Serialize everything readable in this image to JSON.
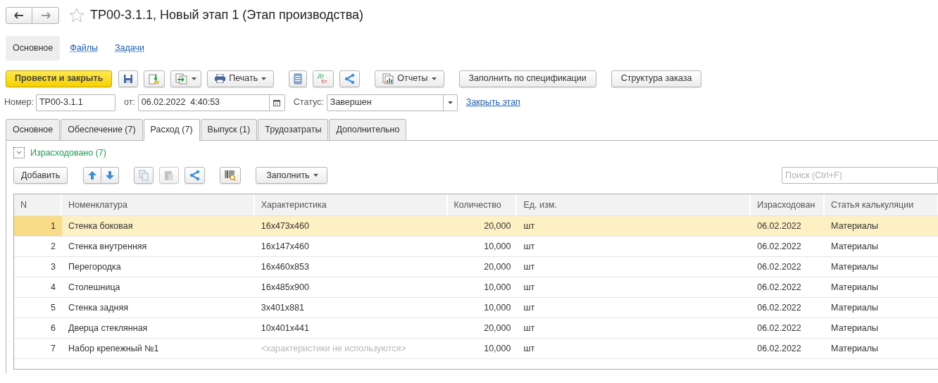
{
  "window": {
    "title": "ТР00-3.1.1, Новый этап 1 (Этап производства)",
    "favorite": false
  },
  "sections": [
    {
      "label": "Основное",
      "selected": true
    },
    {
      "label": "Файлы",
      "selected": false
    },
    {
      "label": "Задачи",
      "selected": false
    }
  ],
  "toolbar": {
    "primary": "Провести и закрыть",
    "print": "Печать",
    "reports": "Отчеты",
    "fill_spec": "Заполнить по спецификации",
    "structure": "Структура заказа",
    "debit_credit": [
      "Дт",
      "Кт"
    ]
  },
  "header": {
    "number_label": "Номер:",
    "number": "ТР00-3.1.1",
    "date_label": "от:",
    "date": "06.02.2022  4:40:53",
    "status_label": "Статус:",
    "status": "Завершен",
    "close_link": "Закрыть этап"
  },
  "tabs": [
    {
      "label": "Основное",
      "selected": false
    },
    {
      "label": "Обеспечение (7)",
      "selected": false
    },
    {
      "label": "Расход (7)",
      "selected": true
    },
    {
      "label": "Выпуск (1)",
      "selected": false
    },
    {
      "label": "Трудозатраты",
      "selected": false
    },
    {
      "label": "Дополнительно",
      "selected": false
    }
  ],
  "group": {
    "title": "Израсходовано (7)",
    "expanded": true
  },
  "table_toolbar": {
    "add": "Добавить",
    "fill": "Заполнить",
    "search_placeholder": "Поиск (Ctrl+F)"
  },
  "table": {
    "columns": [
      "N",
      "Номенклатура",
      "Характеристика",
      "Количество",
      "Ед. изм.",
      "Израсходован",
      "Статья калькуляции"
    ],
    "rows": [
      {
        "n": "1",
        "item": "Стенка боковая",
        "characteristic": "16х473х460",
        "characteristic_placeholder": false,
        "quantity": "20,000",
        "unit": "шт",
        "date": "06.02.2022",
        "article": "Материалы",
        "selected": true
      },
      {
        "n": "2",
        "item": "Стенка внутренняя",
        "characteristic": "16х147х460",
        "characteristic_placeholder": false,
        "quantity": "10,000",
        "unit": "шт",
        "date": "06.02.2022",
        "article": "Материалы",
        "selected": false
      },
      {
        "n": "3",
        "item": "Перегородка",
        "characteristic": "16х460х853",
        "characteristic_placeholder": false,
        "quantity": "20,000",
        "unit": "шт",
        "date": "06.02.2022",
        "article": "Материалы",
        "selected": false
      },
      {
        "n": "4",
        "item": "Столешница",
        "characteristic": "16х485х900",
        "characteristic_placeholder": false,
        "quantity": "10,000",
        "unit": "шт",
        "date": "06.02.2022",
        "article": "Материалы",
        "selected": false
      },
      {
        "n": "5",
        "item": "Стенка задняя",
        "characteristic": "3х401х881",
        "characteristic_placeholder": false,
        "quantity": "10,000",
        "unit": "шт",
        "date": "06.02.2022",
        "article": "Материалы",
        "selected": false
      },
      {
        "n": "6",
        "item": "Дверца стеклянная",
        "characteristic": "10х401х441",
        "characteristic_placeholder": false,
        "quantity": "20,000",
        "unit": "шт",
        "date": "06.02.2022",
        "article": "Материалы",
        "selected": false
      },
      {
        "n": "7",
        "item": "Набор крепежный №1",
        "characteristic": "<характеристики не используются>",
        "characteristic_placeholder": true,
        "quantity": "10,000",
        "unit": "шт",
        "date": "06.02.2022",
        "article": "Материалы",
        "selected": false
      }
    ]
  }
}
